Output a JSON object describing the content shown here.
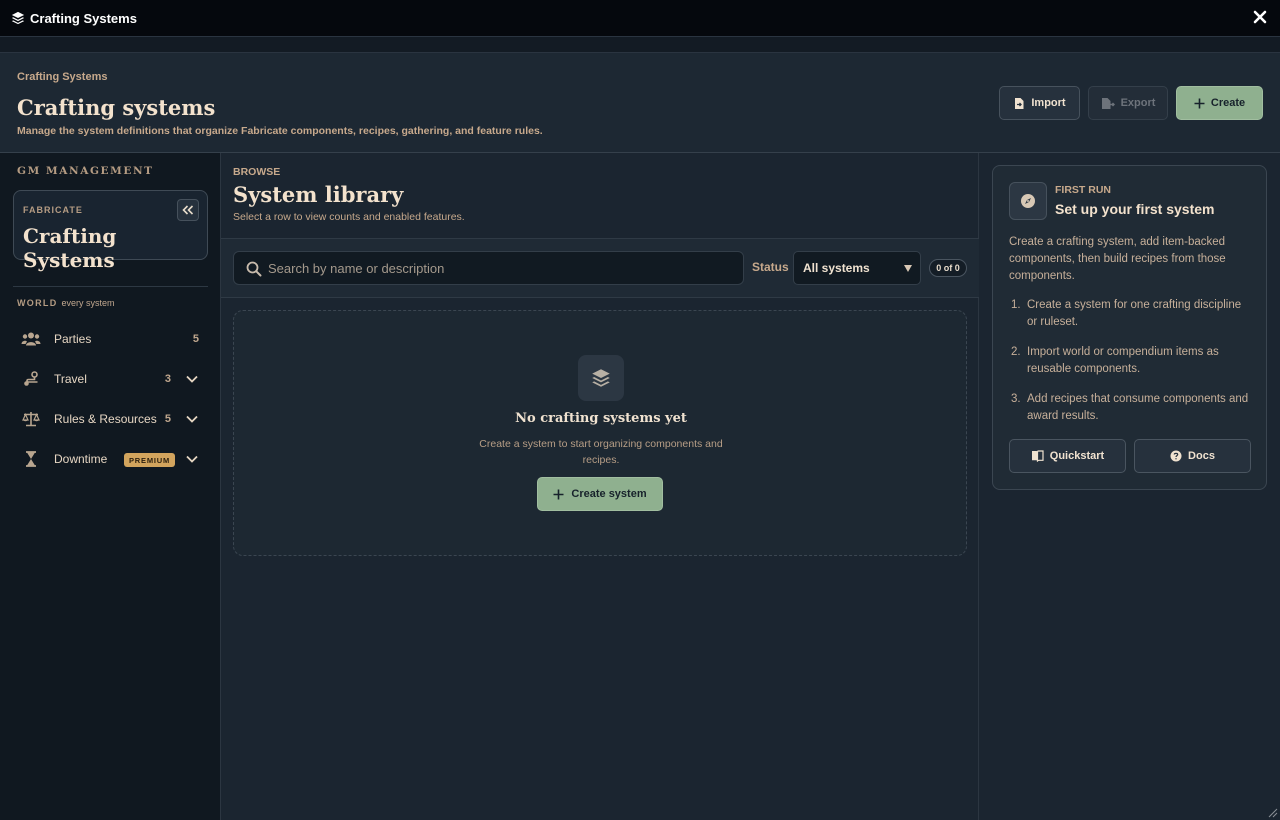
{
  "window": {
    "title": "Crafting Systems"
  },
  "header": {
    "breadcrumb": "Crafting Systems",
    "title": "Crafting systems",
    "description": "Manage the system definitions that organize Fabricate components, recipes, gathering, and feature rules.",
    "import_label": "Import",
    "export_label": "Export",
    "create_label": "Create"
  },
  "sidebar": {
    "heading": "GM MANAGEMENT",
    "card_label": "FABRICATE",
    "card_title": "Crafting Systems",
    "world_label": "WORLD",
    "world_scope": "every system",
    "items": [
      {
        "label": "Parties",
        "count": "5",
        "icon": "users-icon"
      },
      {
        "label": "Travel",
        "count": "3",
        "icon": "route-icon"
      },
      {
        "label": "Rules & Resources",
        "count": "5",
        "icon": "scales-icon"
      },
      {
        "label": "Downtime",
        "badge": "PREMIUM",
        "icon": "hourglass-icon"
      }
    ]
  },
  "main": {
    "browse_label": "BROWSE",
    "title": "System library",
    "description": "Select a row to view counts and enabled features.",
    "search_placeholder": "Search by name or description",
    "status_label": "Status",
    "status_value": "All systems",
    "count_pill": "0 of 0",
    "empty_title": "No crafting systems yet",
    "empty_desc": "Create a system to start organizing components and recipes.",
    "empty_button": "Create system"
  },
  "panel": {
    "label": "FIRST RUN",
    "title": "Set up your first system",
    "description": "Create a crafting system, add item-backed components, then build recipes from those components.",
    "steps": [
      {
        "num": "1.",
        "text": "Create a system for one crafting discipline or ruleset."
      },
      {
        "num": "2.",
        "text": "Import world or compendium items as reusable components."
      },
      {
        "num": "3.",
        "text": "Add recipes that consume components and award results."
      }
    ],
    "quickstart_label": "Quickstart",
    "docs_label": "Docs"
  },
  "colors": {
    "accent_green": "#8fb08f",
    "premium_badge": "#d2a45d",
    "text_tan": "#c7a98c"
  }
}
